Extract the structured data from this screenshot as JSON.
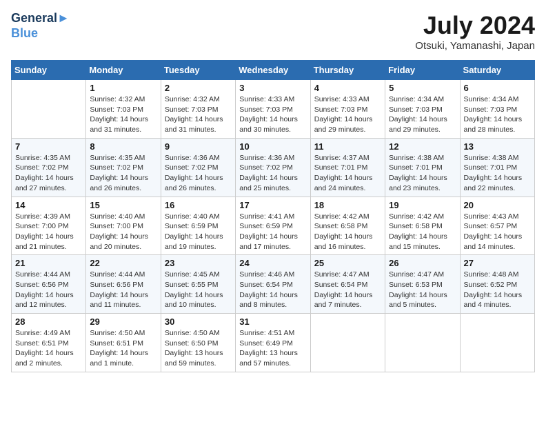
{
  "header": {
    "logo_line1": "General",
    "logo_line2": "Blue",
    "title": "July 2024",
    "subtitle": "Otsuki, Yamanashi, Japan"
  },
  "days_of_week": [
    "Sunday",
    "Monday",
    "Tuesday",
    "Wednesday",
    "Thursday",
    "Friday",
    "Saturday"
  ],
  "weeks": [
    [
      {
        "day": "",
        "info": ""
      },
      {
        "day": "1",
        "info": "Sunrise: 4:32 AM\nSunset: 7:03 PM\nDaylight: 14 hours\nand 31 minutes."
      },
      {
        "day": "2",
        "info": "Sunrise: 4:32 AM\nSunset: 7:03 PM\nDaylight: 14 hours\nand 31 minutes."
      },
      {
        "day": "3",
        "info": "Sunrise: 4:33 AM\nSunset: 7:03 PM\nDaylight: 14 hours\nand 30 minutes."
      },
      {
        "day": "4",
        "info": "Sunrise: 4:33 AM\nSunset: 7:03 PM\nDaylight: 14 hours\nand 29 minutes."
      },
      {
        "day": "5",
        "info": "Sunrise: 4:34 AM\nSunset: 7:03 PM\nDaylight: 14 hours\nand 29 minutes."
      },
      {
        "day": "6",
        "info": "Sunrise: 4:34 AM\nSunset: 7:03 PM\nDaylight: 14 hours\nand 28 minutes."
      }
    ],
    [
      {
        "day": "7",
        "info": "Sunrise: 4:35 AM\nSunset: 7:02 PM\nDaylight: 14 hours\nand 27 minutes."
      },
      {
        "day": "8",
        "info": "Sunrise: 4:35 AM\nSunset: 7:02 PM\nDaylight: 14 hours\nand 26 minutes."
      },
      {
        "day": "9",
        "info": "Sunrise: 4:36 AM\nSunset: 7:02 PM\nDaylight: 14 hours\nand 26 minutes."
      },
      {
        "day": "10",
        "info": "Sunrise: 4:36 AM\nSunset: 7:02 PM\nDaylight: 14 hours\nand 25 minutes."
      },
      {
        "day": "11",
        "info": "Sunrise: 4:37 AM\nSunset: 7:01 PM\nDaylight: 14 hours\nand 24 minutes."
      },
      {
        "day": "12",
        "info": "Sunrise: 4:38 AM\nSunset: 7:01 PM\nDaylight: 14 hours\nand 23 minutes."
      },
      {
        "day": "13",
        "info": "Sunrise: 4:38 AM\nSunset: 7:01 PM\nDaylight: 14 hours\nand 22 minutes."
      }
    ],
    [
      {
        "day": "14",
        "info": "Sunrise: 4:39 AM\nSunset: 7:00 PM\nDaylight: 14 hours\nand 21 minutes."
      },
      {
        "day": "15",
        "info": "Sunrise: 4:40 AM\nSunset: 7:00 PM\nDaylight: 14 hours\nand 20 minutes."
      },
      {
        "day": "16",
        "info": "Sunrise: 4:40 AM\nSunset: 6:59 PM\nDaylight: 14 hours\nand 19 minutes."
      },
      {
        "day": "17",
        "info": "Sunrise: 4:41 AM\nSunset: 6:59 PM\nDaylight: 14 hours\nand 17 minutes."
      },
      {
        "day": "18",
        "info": "Sunrise: 4:42 AM\nSunset: 6:58 PM\nDaylight: 14 hours\nand 16 minutes."
      },
      {
        "day": "19",
        "info": "Sunrise: 4:42 AM\nSunset: 6:58 PM\nDaylight: 14 hours\nand 15 minutes."
      },
      {
        "day": "20",
        "info": "Sunrise: 4:43 AM\nSunset: 6:57 PM\nDaylight: 14 hours\nand 14 minutes."
      }
    ],
    [
      {
        "day": "21",
        "info": "Sunrise: 4:44 AM\nSunset: 6:56 PM\nDaylight: 14 hours\nand 12 minutes."
      },
      {
        "day": "22",
        "info": "Sunrise: 4:44 AM\nSunset: 6:56 PM\nDaylight: 14 hours\nand 11 minutes."
      },
      {
        "day": "23",
        "info": "Sunrise: 4:45 AM\nSunset: 6:55 PM\nDaylight: 14 hours\nand 10 minutes."
      },
      {
        "day": "24",
        "info": "Sunrise: 4:46 AM\nSunset: 6:54 PM\nDaylight: 14 hours\nand 8 minutes."
      },
      {
        "day": "25",
        "info": "Sunrise: 4:47 AM\nSunset: 6:54 PM\nDaylight: 14 hours\nand 7 minutes."
      },
      {
        "day": "26",
        "info": "Sunrise: 4:47 AM\nSunset: 6:53 PM\nDaylight: 14 hours\nand 5 minutes."
      },
      {
        "day": "27",
        "info": "Sunrise: 4:48 AM\nSunset: 6:52 PM\nDaylight: 14 hours\nand 4 minutes."
      }
    ],
    [
      {
        "day": "28",
        "info": "Sunrise: 4:49 AM\nSunset: 6:51 PM\nDaylight: 14 hours\nand 2 minutes."
      },
      {
        "day": "29",
        "info": "Sunrise: 4:50 AM\nSunset: 6:51 PM\nDaylight: 14 hours\nand 1 minute."
      },
      {
        "day": "30",
        "info": "Sunrise: 4:50 AM\nSunset: 6:50 PM\nDaylight: 13 hours\nand 59 minutes."
      },
      {
        "day": "31",
        "info": "Sunrise: 4:51 AM\nSunset: 6:49 PM\nDaylight: 13 hours\nand 57 minutes."
      },
      {
        "day": "",
        "info": ""
      },
      {
        "day": "",
        "info": ""
      },
      {
        "day": "",
        "info": ""
      }
    ]
  ]
}
